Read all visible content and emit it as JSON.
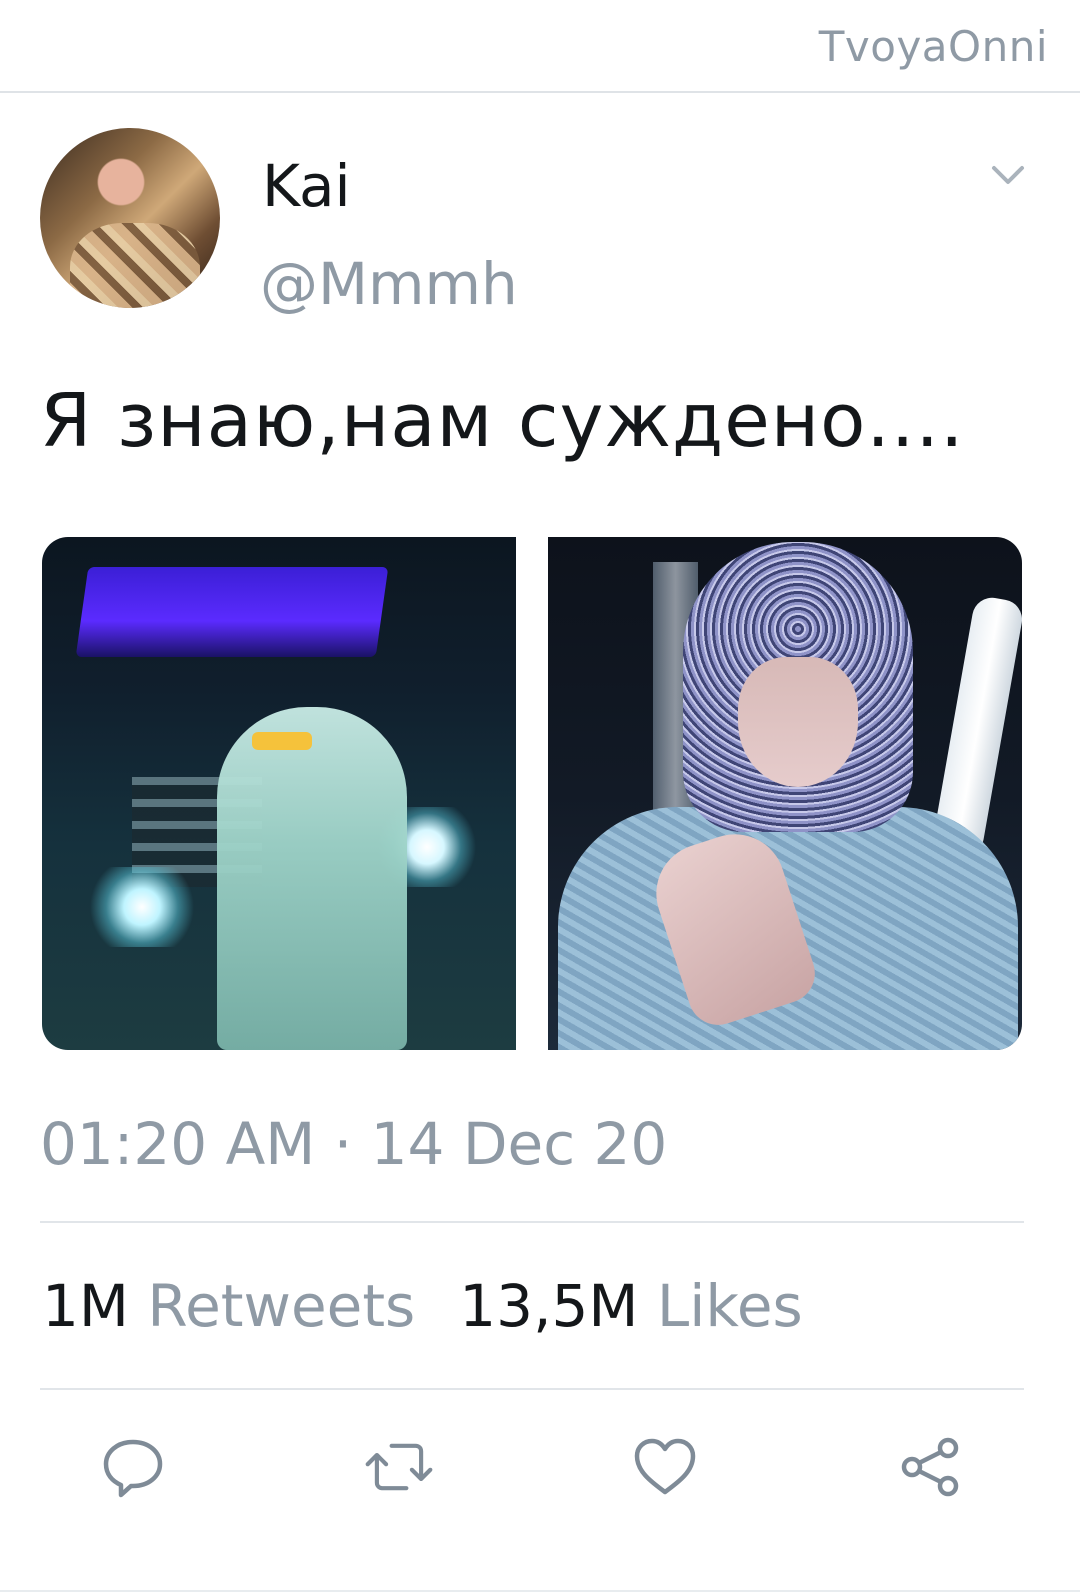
{
  "header": {
    "brand": "TvoyaOnni"
  },
  "tweet": {
    "author_name": "Kai",
    "author_handle": "@Mmmh",
    "text": "Я знаю,нам суждено....",
    "time": "01:20 AM · 14 Dec 20",
    "retweets_count": "1M",
    "retweets_label": "Retweets",
    "likes_count": "13,5M",
    "likes_label": "Likes"
  },
  "icons": {
    "avatar": "avatar",
    "more": "chevron-down-icon",
    "reply": "reply-icon",
    "retweet": "retweet-icon",
    "like": "heart-icon",
    "share": "share-icon"
  },
  "colors": {
    "text": "#14171a",
    "muted": "#8f9aa5",
    "divider": "#e1e5e9"
  }
}
